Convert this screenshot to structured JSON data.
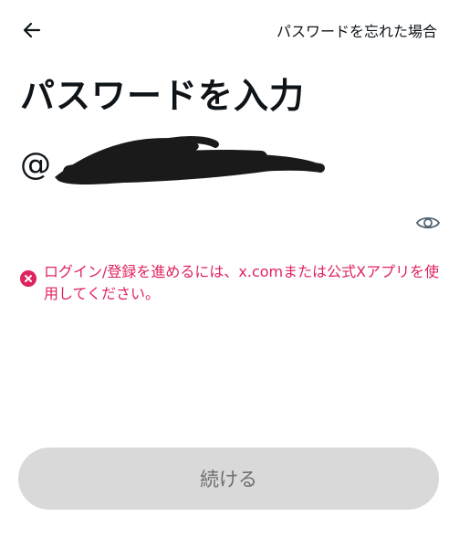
{
  "header": {
    "back_icon": "arrow-left-icon",
    "forgot_password_link": "パスワードを忘れた場合"
  },
  "main": {
    "title": "パスワードを入力",
    "account_prefix": "@",
    "password": {
      "value": "",
      "placeholder": ""
    },
    "visibility_icon": "eye-icon",
    "error": {
      "icon": "error-x-circle-icon",
      "message": "ログイン/登録を進めるには、x.comまたは公式Xアプリを使用してください。"
    }
  },
  "footer": {
    "continue_button": "続ける"
  },
  "colors": {
    "text": "#0f1419",
    "error": "#e0245e",
    "button_disabled_bg": "#d9d9d9",
    "button_disabled_text": "#6e6e6e",
    "redaction": "#1a1a1a"
  }
}
